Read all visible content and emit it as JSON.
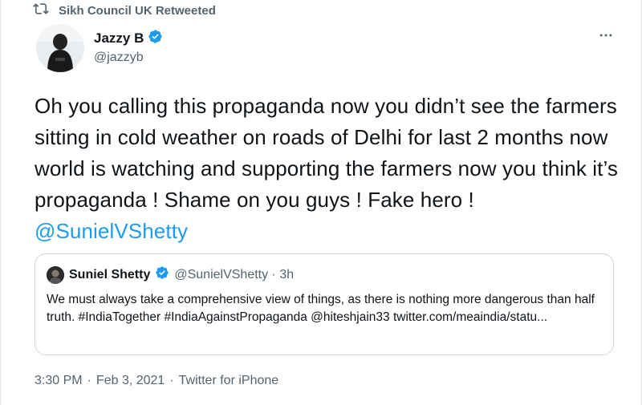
{
  "retweet_bar": {
    "label": "Sikh Council UK Retweeted",
    "icon": "retweet-icon"
  },
  "tweet": {
    "author": {
      "name": "Jazzy B",
      "handle": "@jazzyb",
      "verified": true,
      "avatar_icon": "avatar-person"
    },
    "more_icon": "more-horizontal-icon",
    "text": "Oh you calling this propaganda now you didn’t see the farmers sitting in cold weather on roads of Delhi for last 2 months now world is watching and supporting the farmers now you think it’s propaganda ! Shame on you guys ! Fake hero ! ",
    "mention": "@SunielVShetty"
  },
  "quoted_tweet": {
    "name": "Suniel Shetty",
    "handle_time": "@SunielVShetty · 3h",
    "verified": true,
    "text": "We must always take a comprehensive view of things, as there is nothing more dangerous than half truth. #IndiaTogether #IndiaAgainstPropaganda @hiteshjain33 twitter.com/meaindia/statu..."
  },
  "meta": {
    "time": "3:30 PM",
    "date": "Feb 3, 2021",
    "source": "Twitter for iPhone",
    "separator": "·"
  },
  "colors": {
    "text": "#0f1419",
    "secondary": "#536471",
    "link": "#1d9bf0",
    "verified": "#1d9bf0",
    "border": "#cfd9de"
  }
}
